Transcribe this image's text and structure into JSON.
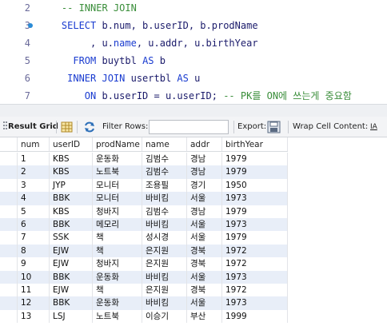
{
  "editor": {
    "lines": [
      {
        "num": "2",
        "segments": [
          {
            "t": "    -- INNER JOIN",
            "c": "cm"
          }
        ]
      },
      {
        "num": "3",
        "dot": true,
        "segments": [
          {
            "t": "    SELECT ",
            "c": "kw"
          },
          {
            "t": "b.num, b.userID, b.prodName",
            "c": ""
          }
        ]
      },
      {
        "num": "4",
        "segments": [
          {
            "t": "         , u.",
            "c": ""
          },
          {
            "t": "name",
            "c": "hl"
          },
          {
            "t": ", u.addr, u.birthYear",
            "c": ""
          }
        ]
      },
      {
        "num": "5",
        "segments": [
          {
            "t": "      FROM ",
            "c": "kw"
          },
          {
            "t": "buytbl ",
            "c": ""
          },
          {
            "t": "AS ",
            "c": "kw"
          },
          {
            "t": "b",
            "c": ""
          }
        ]
      },
      {
        "num": "6",
        "segments": [
          {
            "t": "     INNER JOIN ",
            "c": "kw"
          },
          {
            "t": "usertbl ",
            "c": ""
          },
          {
            "t": "AS ",
            "c": "kw"
          },
          {
            "t": "u",
            "c": ""
          }
        ]
      },
      {
        "num": "7",
        "segments": [
          {
            "t": "        ON ",
            "c": "kw"
          },
          {
            "t": "b.userID = u.userID; ",
            "c": ""
          },
          {
            "t": "-- PK를 ON에 쓰는게 중요함",
            "c": "cm"
          }
        ]
      }
    ]
  },
  "toolbar": {
    "result_grid": "Result Grid",
    "filter_rows": "Filter Rows:",
    "filter_value": "",
    "export": "Export:",
    "wrap": "Wrap Cell Content:",
    "wrap_icon": "IA"
  },
  "grid": {
    "columns": [
      "num",
      "userID",
      "prodName",
      "name",
      "addr",
      "birthYear"
    ],
    "rows": [
      [
        "1",
        "KBS",
        "운동화",
        "김범수",
        "경남",
        "1979"
      ],
      [
        "2",
        "KBS",
        "노트북",
        "김범수",
        "경남",
        "1979"
      ],
      [
        "3",
        "JYP",
        "모니터",
        "조용필",
        "경기",
        "1950"
      ],
      [
        "4",
        "BBK",
        "모니터",
        "바비킴",
        "서울",
        "1973"
      ],
      [
        "5",
        "KBS",
        "청바지",
        "김범수",
        "경남",
        "1979"
      ],
      [
        "6",
        "BBK",
        "메모리",
        "바비킴",
        "서울",
        "1973"
      ],
      [
        "7",
        "SSK",
        "책",
        "성시경",
        "서울",
        "1979"
      ],
      [
        "8",
        "EJW",
        "책",
        "은지원",
        "경북",
        "1972"
      ],
      [
        "9",
        "EJW",
        "청바지",
        "은지원",
        "경북",
        "1972"
      ],
      [
        "10",
        "BBK",
        "운동화",
        "바비킴",
        "서울",
        "1973"
      ],
      [
        "11",
        "EJW",
        "책",
        "은지원",
        "경북",
        "1972"
      ],
      [
        "12",
        "BBK",
        "운동화",
        "바비킴",
        "서울",
        "1973"
      ],
      [
        "13",
        "LSJ",
        "노트북",
        "이승기",
        "부산",
        "1999"
      ]
    ]
  }
}
